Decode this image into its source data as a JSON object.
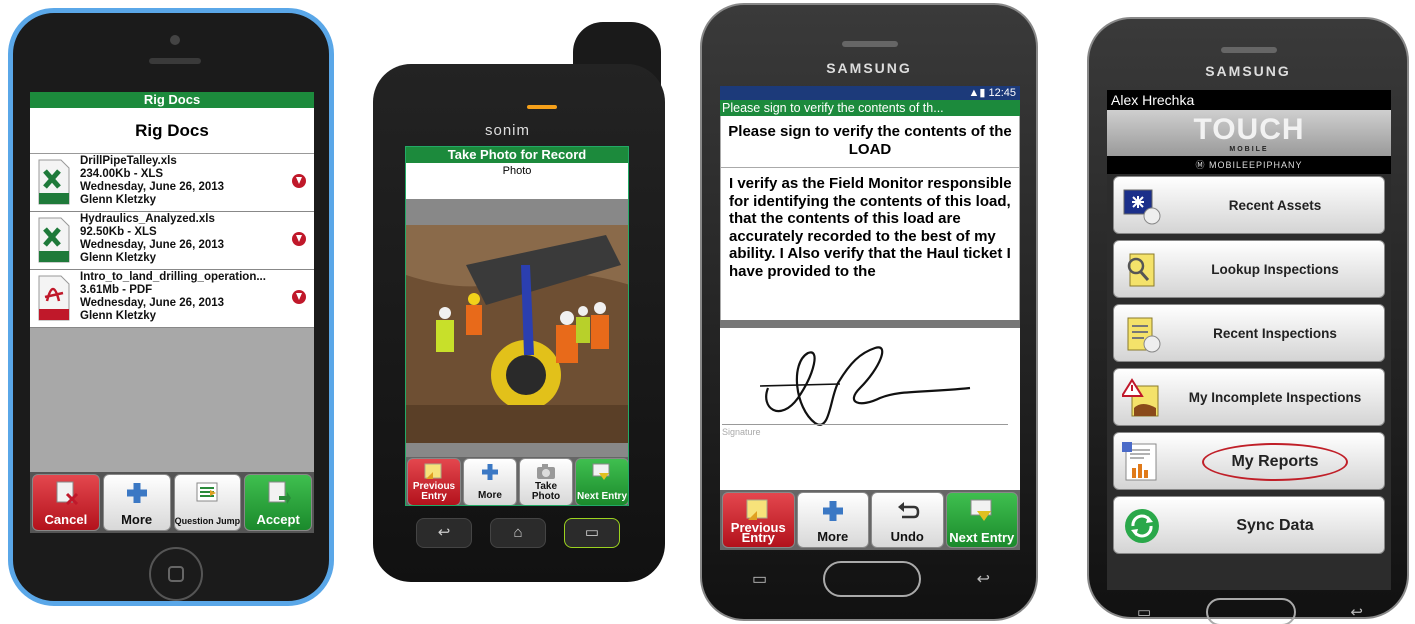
{
  "phone1": {
    "header": "Rig Docs",
    "title": "Rig Docs",
    "documents": [
      {
        "name": "DrillPipeTalley.xls",
        "size": "234.00Kb  -  XLS",
        "date": "Wednesday, June 26, 2013",
        "author": "Glenn Kletzky",
        "type_badge": "XLS",
        "icon": "excel-file-icon"
      },
      {
        "name": "Hydraulics_Analyzed.xls",
        "size": "92.50Kb  -  XLS",
        "date": "Wednesday, June 26, 2013",
        "author": "Glenn Kletzky",
        "type_badge": "XLS",
        "icon": "excel-file-icon"
      },
      {
        "name": "Intro_to_land_drilling_operation...",
        "size": "3.61Mb  -  PDF",
        "date": "Wednesday, June 26, 2013",
        "author": "Glenn Kletzky",
        "type_badge": "PDF",
        "icon": "pdf-file-icon"
      }
    ],
    "toolbar": {
      "cancel": "Cancel",
      "more": "More",
      "question_jump": "Question Jump",
      "accept": "Accept"
    }
  },
  "phone2": {
    "brand": "sonim",
    "header": "Take Photo for Record",
    "field_label": "Photo",
    "toolbar": {
      "previous": "Previous Entry",
      "more": "More",
      "take_photo": "Take Photo",
      "next": "Next Entry"
    }
  },
  "phone3": {
    "brand": "SAMSUNG",
    "status_time": "12:45",
    "header": "Please sign to verify the contents of th...",
    "question_title": "Please sign to verify the contents of the LOAD",
    "question_text": "I verify as the Field Monitor responsible for identifying the contents of this load, that the contents of this load are accurately recorded to the best of my ability.  I Also verify that the Haul ticket I have provided to the",
    "signature_label": "Signature",
    "toolbar": {
      "previous": "Previous Entry",
      "more": "More",
      "undo": "Undo",
      "next": "Next Entry"
    }
  },
  "phone4": {
    "brand": "SAMSUNG",
    "user_name": "Alex  Hrechka",
    "logo_text": "TOUCH",
    "logo_sub": "MOBILE",
    "company": "MOBILEEPIPHANY",
    "menu": [
      {
        "label": "Recent Assets",
        "icon": "recent-assets-icon"
      },
      {
        "label": "Lookup Inspections",
        "icon": "lookup-inspections-icon"
      },
      {
        "label": "Recent Inspections",
        "icon": "recent-inspections-icon"
      },
      {
        "label": "My Incomplete Inspections",
        "icon": "incomplete-inspections-icon"
      },
      {
        "label": "My Reports",
        "icon": "reports-icon"
      },
      {
        "label": "Sync Data",
        "icon": "sync-icon"
      }
    ]
  },
  "colors": {
    "header_green": "#1c8a3c",
    "cancel_red": "#b3121c",
    "accept_green": "#1b8a2c",
    "frame_blue": "#5aa7e8",
    "highlight_circle": "#c01f28"
  }
}
